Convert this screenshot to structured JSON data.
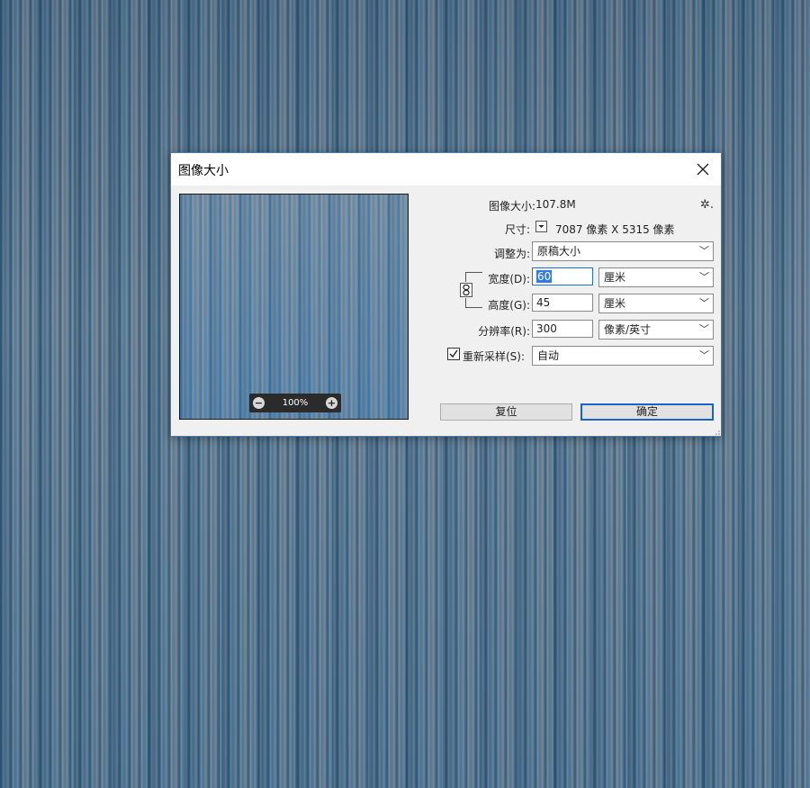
{
  "dialog": {
    "title": "图像大小",
    "image_size_label": "图像大小:",
    "image_size_value": "107.8M",
    "dimensions_label": "尺寸:",
    "dimensions_value": "7087 像素  X  5315 像素",
    "fit_to_label": "调整为:",
    "fit_to_value": "原稿大小",
    "width_label": "宽度(D):",
    "width_value": "60",
    "width_unit": "厘米",
    "height_label": "高度(G):",
    "height_value": "45",
    "height_unit": "厘米",
    "resolution_label": "分辨率(R):",
    "resolution_value": "300",
    "resolution_unit": "像素/英寸",
    "resample_label": "重新采样(S):",
    "resample_checked": true,
    "resample_value": "自动",
    "reset_button": "复位",
    "ok_button": "确定",
    "zoom_level": "100%",
    "zoom_out_symbol": "−",
    "zoom_in_symbol": "+"
  },
  "icons": {
    "close": "close-icon",
    "settings": "gear-icon",
    "link": "chain-link-icon",
    "dropdown": "chevron-down-icon"
  },
  "colors": {
    "accent": "#1a64c6",
    "selection": "#2f7be0",
    "dialog_bg": "#f0f0f0",
    "border": "#4a7cb3"
  }
}
